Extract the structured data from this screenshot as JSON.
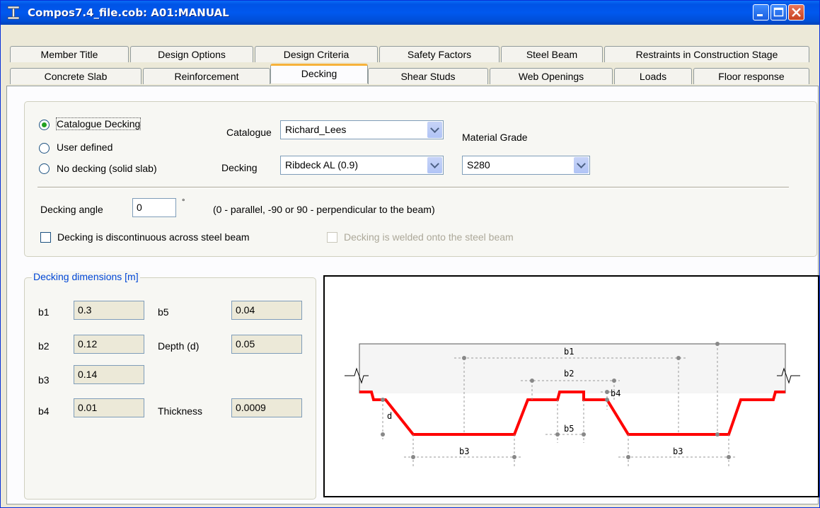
{
  "window": {
    "title": "Compos7.4_file.cob: A01:MANUAL"
  },
  "tabs_row1": [
    "Member Title",
    "Design Options",
    "Design Criteria",
    "Safety Factors",
    "Steel Beam",
    "Restraints in Construction Stage"
  ],
  "tabs_row2": [
    "Concrete Slab",
    "Reinforcement",
    "Decking",
    "Shear Studs",
    "Web Openings",
    "Loads",
    "Floor response"
  ],
  "active_tab": "Decking",
  "decking_type": {
    "options": [
      "Catalogue Decking",
      "User defined",
      "No decking (solid slab)"
    ],
    "selected": "Catalogue Decking"
  },
  "catalogue": {
    "label": "Catalogue",
    "value": "Richard_Lees"
  },
  "decking": {
    "label": "Decking",
    "value": "Ribdeck AL (0.9)"
  },
  "material_grade": {
    "label": "Material Grade",
    "value": "S280"
  },
  "decking_angle": {
    "label": "Decking angle",
    "value": "0",
    "unit": "°",
    "hint": "(0 - parallel,  -90 or 90 - perpendicular to the beam)"
  },
  "checkboxes": {
    "discontinuous": "Decking is discontinuous across steel beam",
    "welded": "Decking is welded onto the steel beam"
  },
  "dimensions": {
    "title": "Decking dimensions [m]",
    "b1": {
      "label": "b1",
      "value": "0.3"
    },
    "b2": {
      "label": "b2",
      "value": "0.12"
    },
    "b3": {
      "label": "b3",
      "value": "0.14"
    },
    "b4": {
      "label": "b4",
      "value": "0.01"
    },
    "b5": {
      "label": "b5",
      "value": "0.04"
    },
    "depth": {
      "label": "Depth (d)",
      "value": "0.05"
    },
    "thickness": {
      "label": "Thickness",
      "value": "0.0009"
    }
  },
  "diagram_labels": {
    "b1": "b1",
    "b2": "b2",
    "b3a": "b3",
    "b3b": "b3",
    "b4": "b4",
    "b5": "b5",
    "d": "d"
  },
  "colors": {
    "title_bar": "#0058ee",
    "profile": "#ff0000",
    "group_label": "#0046d5",
    "active_tab_accent": "#f7b23b"
  }
}
